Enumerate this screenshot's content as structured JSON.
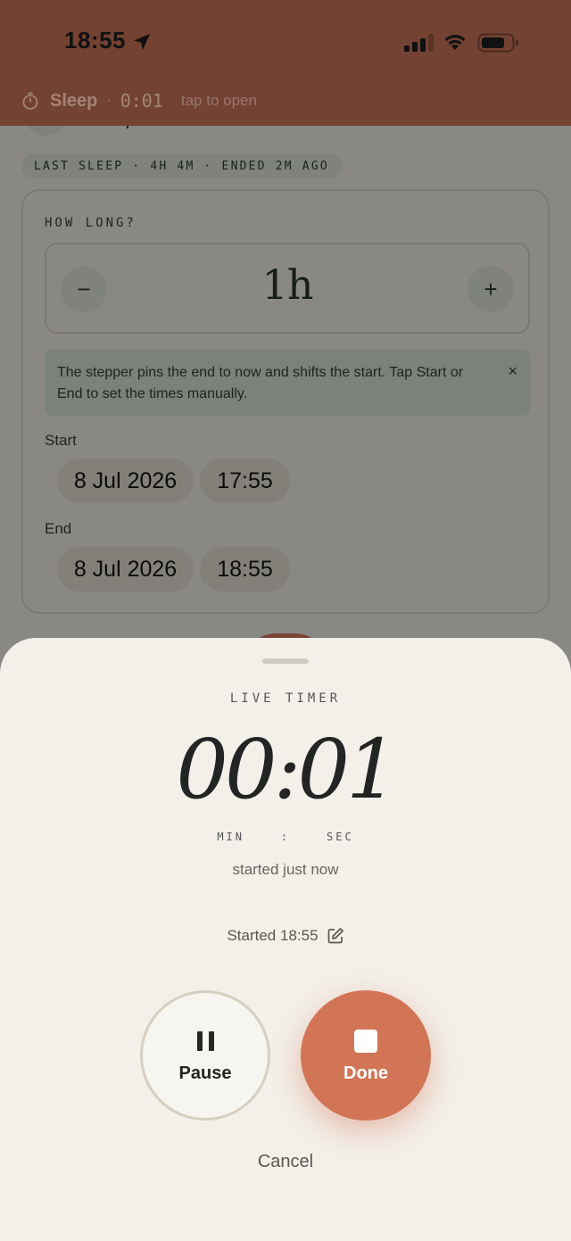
{
  "status_bar": {
    "time": "18:55"
  },
  "live_activity": {
    "title": "Sleep",
    "separator": "·",
    "elapsed": "0:01",
    "hint": "tap to open"
  },
  "background": {
    "last_sleep": "LAST SLEEP · 4H 4M · ENDED 2M AGO",
    "duration": {
      "label": "HOW LONG?",
      "value": "1h",
      "minus": "−",
      "plus": "+"
    },
    "tip": {
      "text": "The stepper pins the end to now and shifts the start. Tap Start or End to set the times manually.",
      "close": "×"
    },
    "start": {
      "label": "Start",
      "date": "8 Jul 2026",
      "time": "17:55"
    },
    "end": {
      "label": "End",
      "date": "8 Jul 2026",
      "time": "18:55"
    }
  },
  "sheet": {
    "label": "LIVE TIMER",
    "timer": "00:01",
    "units": "MIN    :    SEC",
    "started_ago": "started just now",
    "started_at": "Started 18:55",
    "pause_label": "Pause",
    "done_label": "Done",
    "cancel_label": "Cancel"
  },
  "colors": {
    "accent": "#d27456",
    "status_bar": "#744232",
    "sheet_bg": "#f3f0ea",
    "sage": "#d9e5d5"
  }
}
